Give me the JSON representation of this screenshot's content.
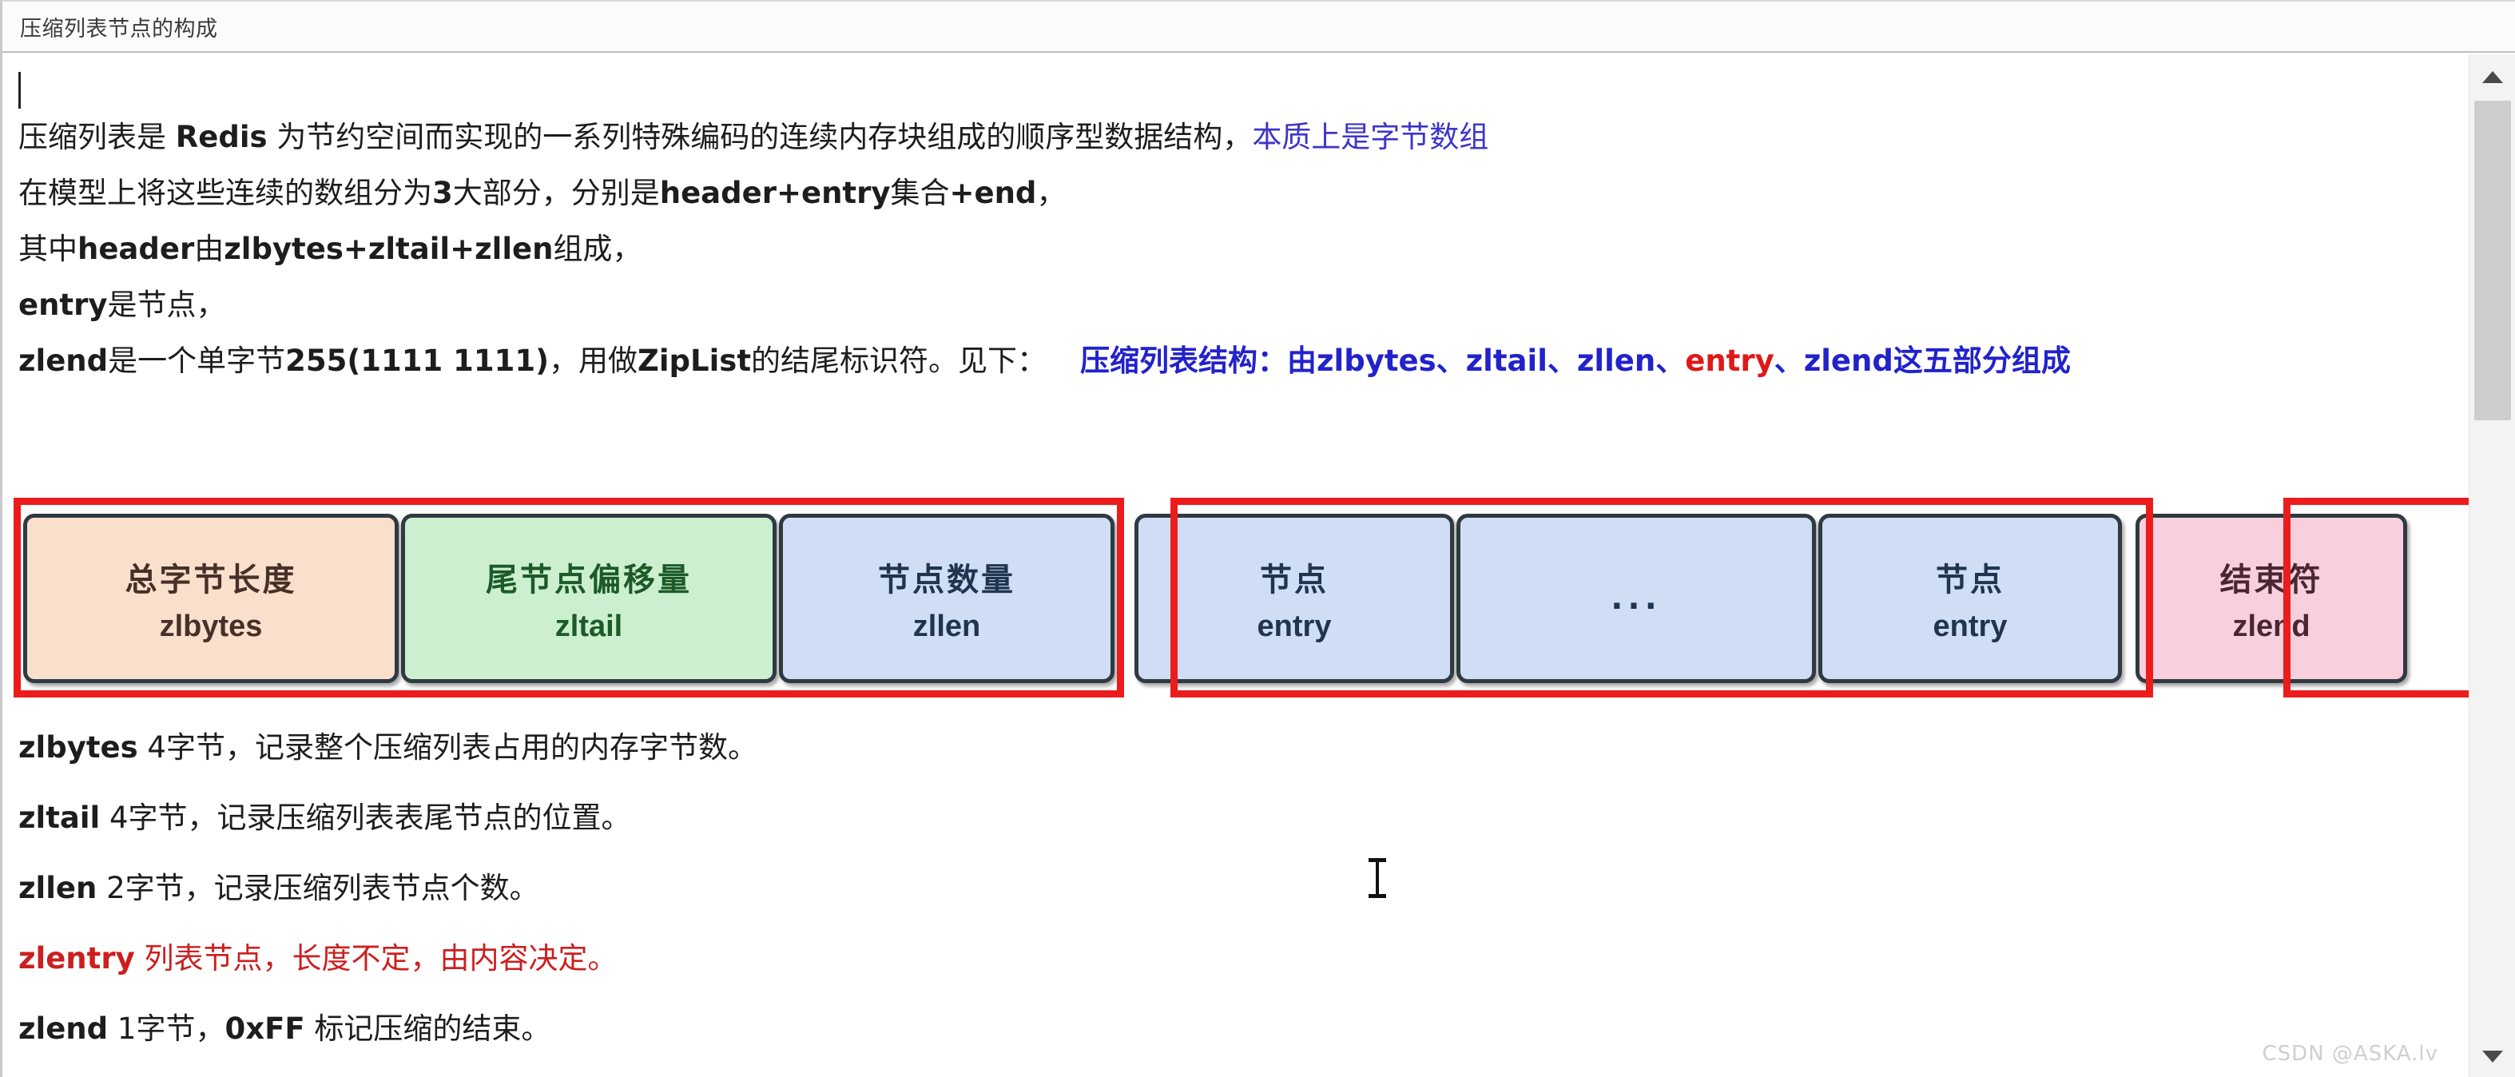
{
  "window": {
    "title": "压缩列表节点的构成"
  },
  "document": {
    "line1": {
      "plain1": "压缩列表是 ",
      "bold1": "Redis",
      "plain2": " 为节约空间而实现的一系列特殊编码的连续内存块组成的顺序型数据结构，",
      "blue": "本质上是字节数组"
    },
    "line2": {
      "plain1": "在模型上将这些连续的数组分为",
      "bold1": "3",
      "plain2": "大部分，分别是",
      "bold2": "header+entry",
      "plain3": "集合",
      "bold3": "+end",
      "plain4": "，"
    },
    "line3": {
      "plain1": "其中",
      "bold1": "header",
      "plain2": "由",
      "bold2": "zlbytes+zltail+zllen",
      "plain3": "组成，"
    },
    "line4": {
      "bold1": "entry",
      "plain1": "是节点，"
    },
    "line5": {
      "bold1": "zlend",
      "plain1": "是一个单字节",
      "bold2": "255(1111 1111)",
      "plain2": "，用做",
      "bold3": "ZipList",
      "plain3": "的结尾标识符。见下：",
      "blue1": "压缩列表结构：由",
      "blue2": "zlbytes、zltail、zllen、",
      "red1": "entry",
      "blue3": "、zlend",
      "blue4": "这五部分组成"
    },
    "desc1": {
      "bold": "zlbytes",
      "plain": "  4字节，记录整个压缩列表占用的内存字节数。"
    },
    "desc2": {
      "bold": "zltail",
      "plain": "   4字节，记录压缩列表表尾节点的位置。"
    },
    "desc3": {
      "bold": "zllen",
      "plain": " 2字节，记录压缩列表节点个数。"
    },
    "desc4": {
      "bold": "zlentry",
      "plain": "  列表节点，长度不定，由内容决定。"
    },
    "desc5": {
      "bold": "zlend",
      "plain": " 1字节，",
      "bold2": "0xFF",
      "plain2": " 标记压缩的结束。"
    }
  },
  "diagram": {
    "cells": [
      {
        "label": "总字节长度",
        "name": "zlbytes",
        "color": "#fae0cc"
      },
      {
        "label": "尾节点偏移量",
        "name": "zltail",
        "color": "#ccf0cf"
      },
      {
        "label": "节点数量",
        "name": "zllen",
        "color": "#cfdef5"
      },
      {
        "label": "节点",
        "name": "entry",
        "color": "#cfdef5"
      },
      {
        "label": "...",
        "name": "",
        "color": "#cfdef5"
      },
      {
        "label": "节点",
        "name": "entry",
        "color": "#cfdef5"
      },
      {
        "label": "结束符",
        "name": "zlend",
        "color": "#f8cfdd"
      }
    ],
    "highlight_color": "#ec1c1c"
  },
  "watermark": "CSDN @ASKA.lv"
}
